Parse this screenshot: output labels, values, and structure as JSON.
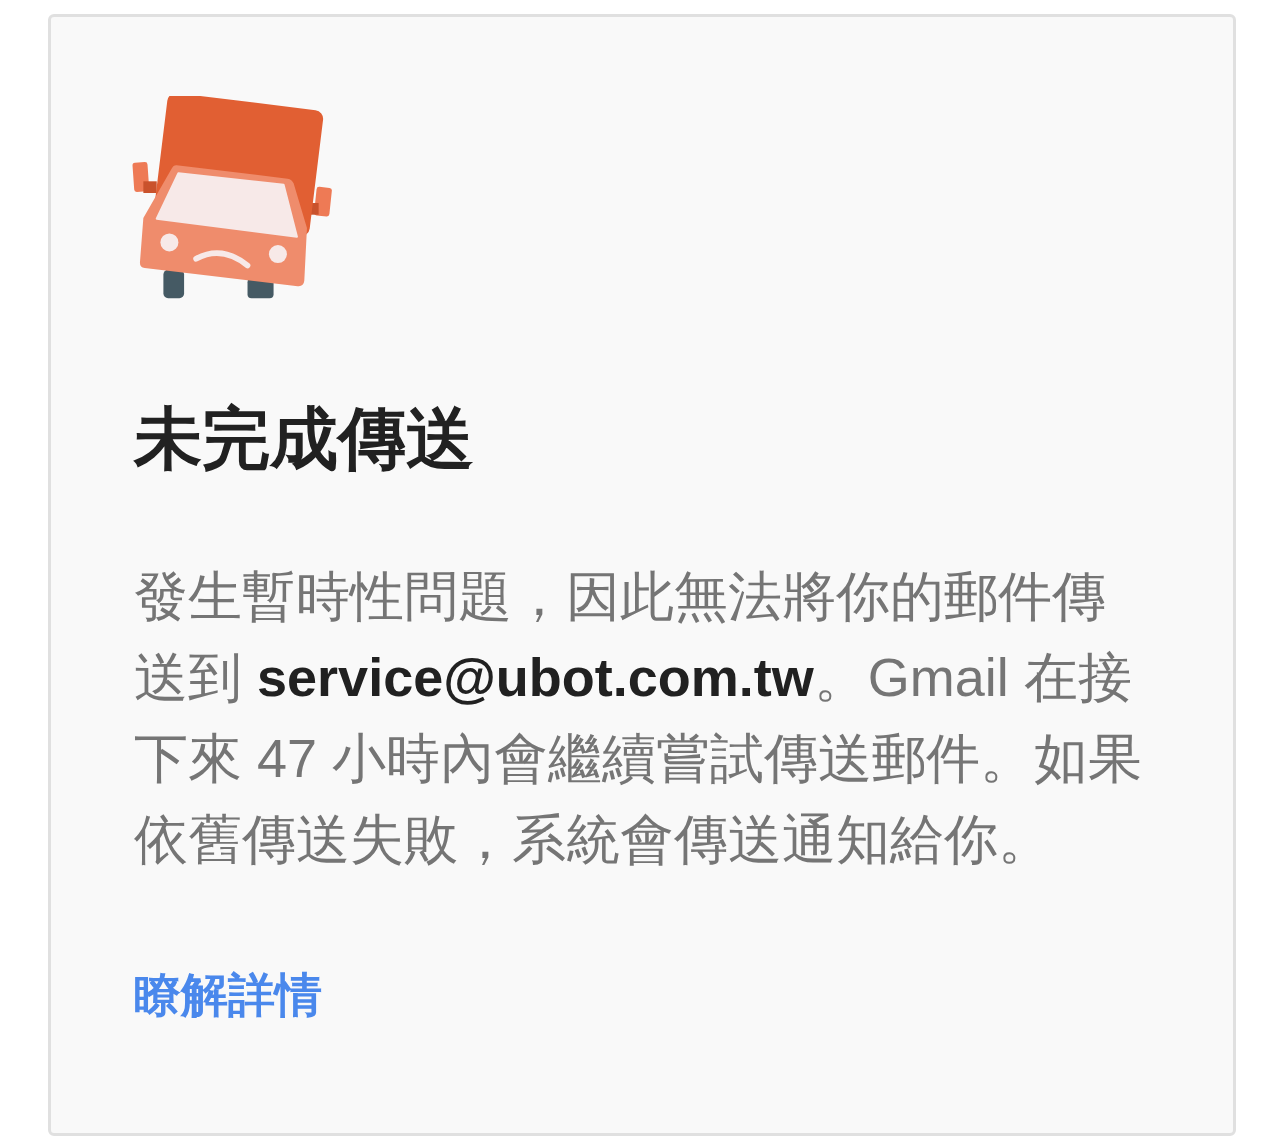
{
  "card": {
    "title": "未完成傳送",
    "message": "發生暫時性問題，因此無法將你的郵件傳送到 **service@ubot.com.tw**。Gmail 在接下來 47 小時內會繼續嘗試傳送郵件。如果依舊傳送失敗，系統會傳送通知給你。",
    "link": "瞭解詳情"
  }
}
